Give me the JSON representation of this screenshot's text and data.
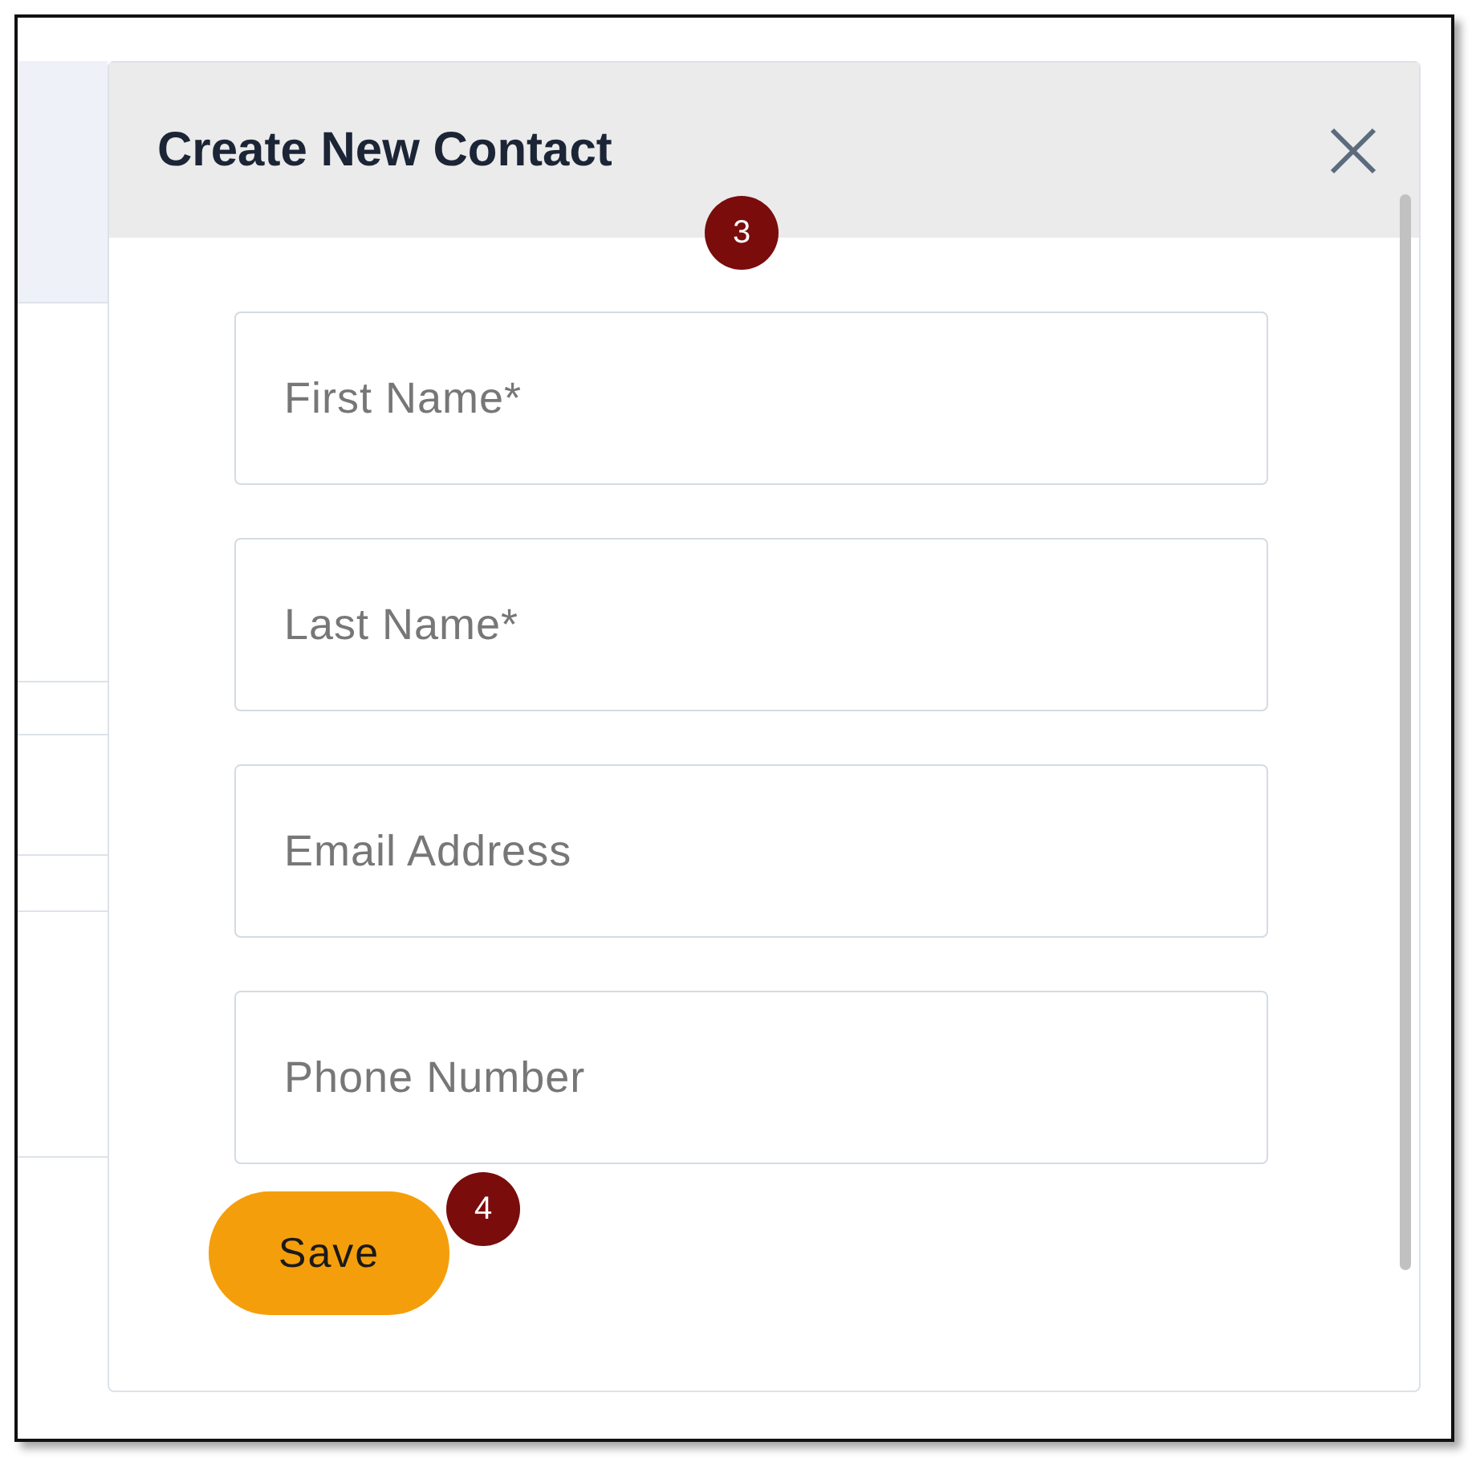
{
  "dialog": {
    "title": "Create New Contact",
    "fields": [
      {
        "placeholder": "First Name*"
      },
      {
        "placeholder": "Last Name*"
      },
      {
        "placeholder": "Email Address"
      },
      {
        "placeholder": "Phone Number"
      }
    ],
    "save_button": "Save"
  },
  "callouts": [
    {
      "label": "3"
    },
    {
      "label": "4"
    }
  ]
}
